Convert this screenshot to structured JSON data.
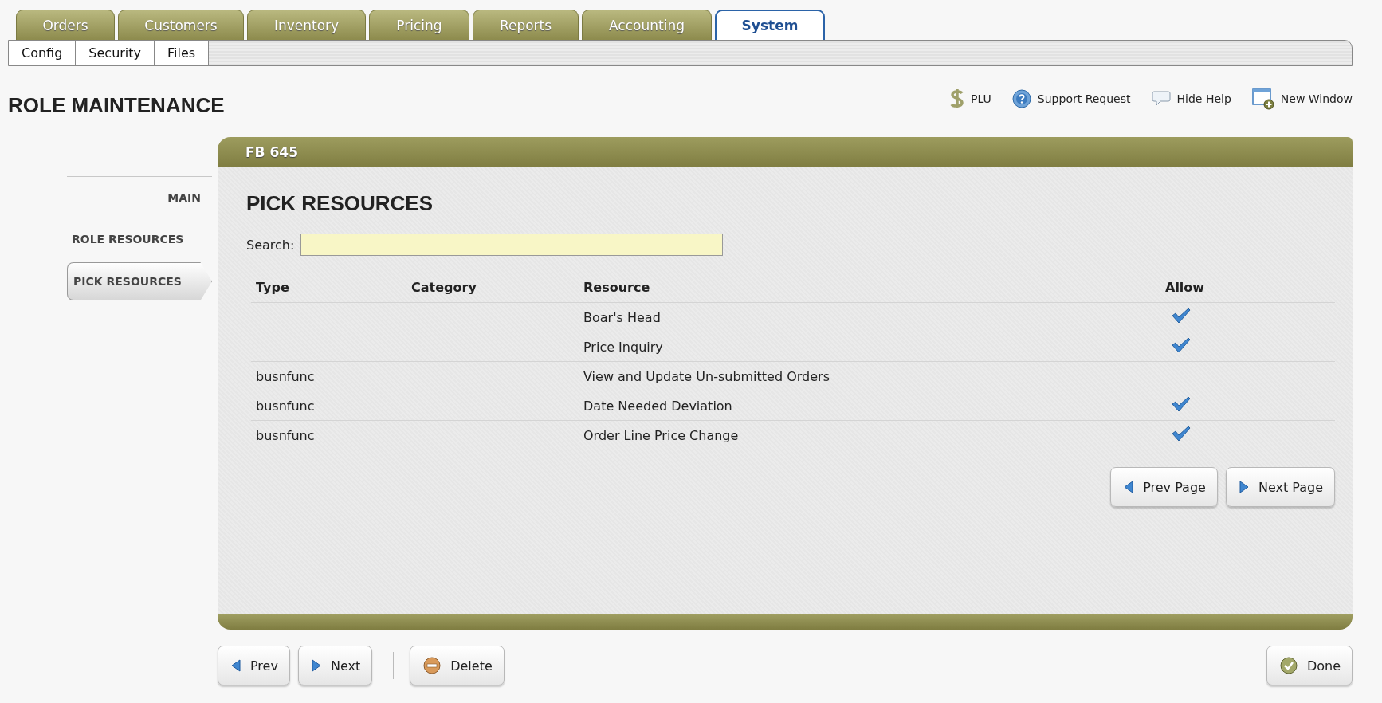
{
  "tabs": [
    {
      "label": "Orders",
      "selected": false
    },
    {
      "label": "Customers",
      "selected": false
    },
    {
      "label": "Inventory",
      "selected": false
    },
    {
      "label": "Pricing",
      "selected": false
    },
    {
      "label": "Reports",
      "selected": false
    },
    {
      "label": "Accounting",
      "selected": false
    },
    {
      "label": "System",
      "selected": true
    }
  ],
  "subtabs": [
    "Config",
    "Security",
    "Files"
  ],
  "page_title": "ROLE MAINTENANCE",
  "header_links": [
    {
      "label": "PLU",
      "kind": "dollar"
    },
    {
      "label": "Support Request",
      "kind": "help"
    },
    {
      "label": "Hide Help",
      "kind": "speech"
    },
    {
      "label": "New Window",
      "kind": "window"
    }
  ],
  "sidebar": {
    "items": [
      {
        "label": "MAIN",
        "selected": false
      },
      {
        "label": "ROLE RESOURCES",
        "selected": false
      },
      {
        "label": "PICK RESOURCES",
        "selected": true
      }
    ]
  },
  "panel": {
    "title": "FB 645",
    "heading": "PICK RESOURCES",
    "search": {
      "label": "Search:"
    },
    "table": {
      "columns": [
        "Type",
        "Category",
        "Resource",
        "Allow"
      ],
      "rows": [
        {
          "resource": "Boar's Head",
          "allow": true
        },
        {
          "resource": "Price Inquiry",
          "allow": true
        },
        {
          "type": "busnfunc",
          "resource": "View and Update Un-submitted Orders",
          "allow": false
        },
        {
          "type": "busnfunc",
          "resource": "Date Needed Deviation",
          "allow": true
        },
        {
          "type": "busnfunc",
          "resource": "Order Line Price Change",
          "allow": true
        }
      ]
    },
    "pager": [
      {
        "label": "Prev Page",
        "kind": "prev"
      },
      {
        "label": "Next Page",
        "kind": "next"
      }
    ]
  },
  "actions": [
    {
      "label": "Prev",
      "kind": "prev"
    },
    {
      "label": "Next",
      "kind": "next"
    },
    {
      "label": "Delete",
      "kind": "delete"
    },
    {
      "label": "Done",
      "kind": "done"
    }
  ]
}
